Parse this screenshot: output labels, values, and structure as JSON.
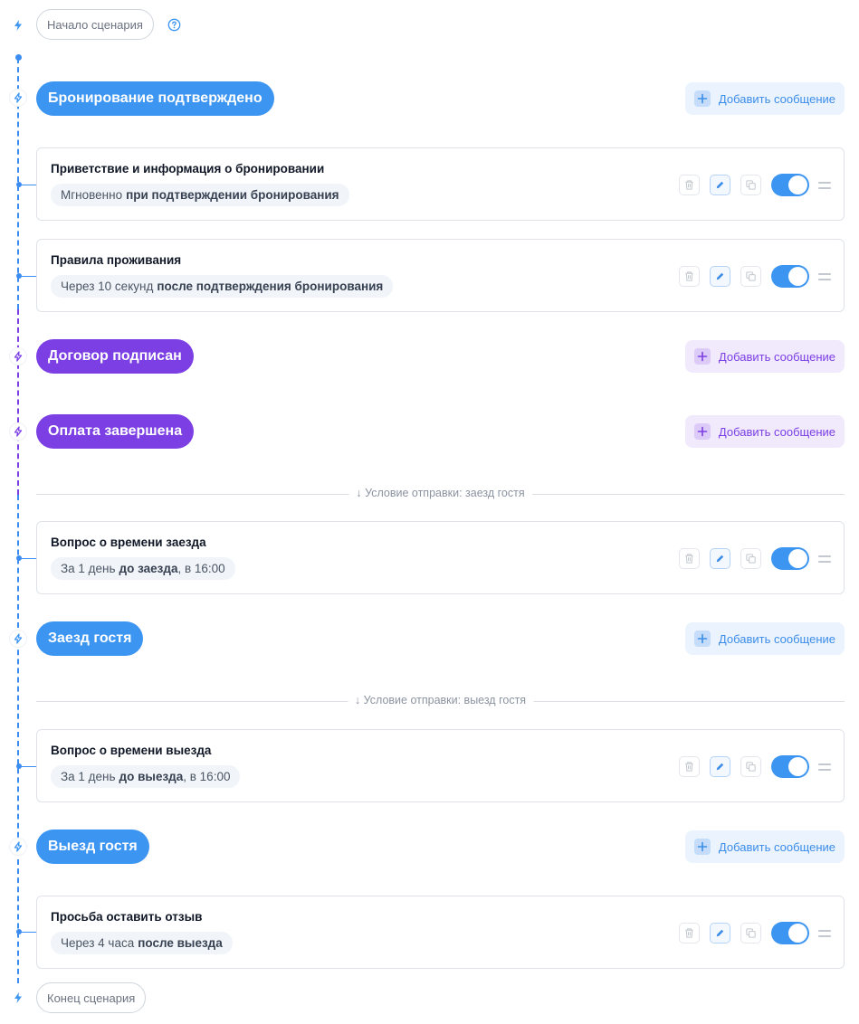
{
  "colors": {
    "blue": "#3d95f2",
    "purple": "#7b3fe4",
    "toggle_on": "#3d95f2"
  },
  "start_label": "Начало сценария",
  "end_label": "Конец сценария",
  "help_icon": "question-circle-icon",
  "events": [
    {
      "label": "Бронирование подтверждено",
      "color": "blue",
      "add_label": "Добавить сообщение"
    },
    {
      "label": "Договор подписан",
      "color": "purple",
      "add_label": "Добавить сообщение"
    },
    {
      "label": "Оплата завершена",
      "color": "purple",
      "add_label": "Добавить сообщение"
    },
    {
      "label": "Заезд гостя",
      "color": "blue",
      "add_label": "Добавить сообщение"
    },
    {
      "label": "Выезд гостя",
      "color": "blue",
      "add_label": "Добавить сообщение"
    }
  ],
  "conditions": [
    {
      "label": "↓ Условие отправки: заезд гостя"
    },
    {
      "label": "↓ Условие отправки: выезд гостя"
    }
  ],
  "messages": [
    {
      "title": "Приветствие и информация о бронировании",
      "timing": "Мгновенно",
      "event": "при подтверждении бронирования",
      "tail": "",
      "enabled": true
    },
    {
      "title": "Правила проживания",
      "timing": "Через 10 секунд",
      "event": "после подтверждения бронирования",
      "tail": "",
      "enabled": true
    },
    {
      "title": "Вопрос о времени заезда",
      "timing": "За 1 день",
      "event": "до заезда",
      "tail": ", в 16:00",
      "enabled": true
    },
    {
      "title": "Вопрос о времени выезда",
      "timing": "За 1 день",
      "event": "до выезда",
      "tail": ", в 16:00",
      "enabled": true
    },
    {
      "title": "Просьба оставить отзыв",
      "timing": "Через 4 часа",
      "event": "после выезда",
      "tail": "",
      "enabled": true
    }
  ]
}
